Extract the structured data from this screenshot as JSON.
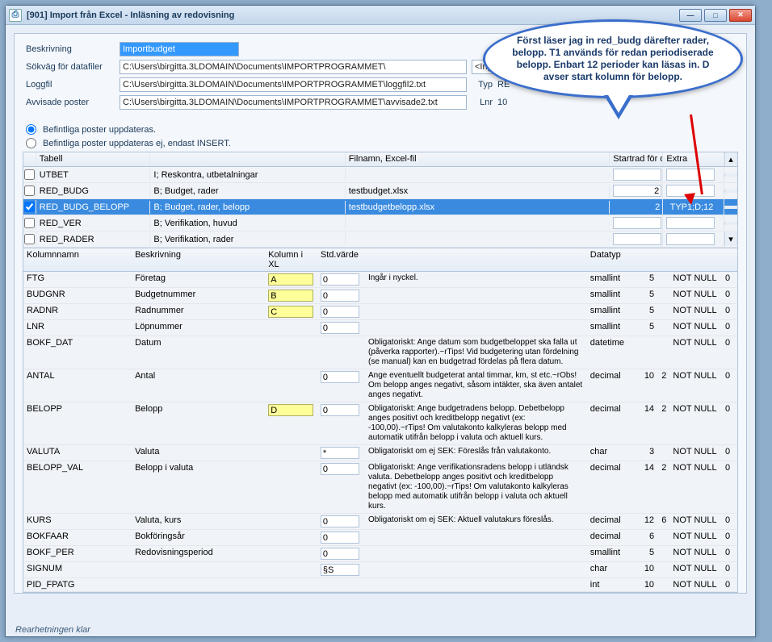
{
  "window": {
    "title": "[901]  Import från Excel - Inläsning av redovisning"
  },
  "form": {
    "beskrivning_lbl": "Beskrivning",
    "beskrivning_val": "Importbudget",
    "sokvag_lbl": "Sökväg för datafiler",
    "sokvag_val": "C:\\Users\\birgitta.3LDOMAIN\\Documents\\IMPORTPROGRAMMET\\",
    "loggfil_lbl": "Loggfil",
    "loggfil_val": "C:\\Users\\birgitta.3LDOMAIN\\Documents\\IMPORTPROGRAMMET\\loggfil2.txt",
    "avvisade_lbl": "Avvisade poster",
    "avvisade_val": "C:\\Users\\birgitta.3LDOMAIN\\Documents\\IMPORTPROGRAMMET\\avvisade2.txt",
    "ingen": "<Ingen>",
    "typ_lbl": "Typ",
    "typ_val": "RE",
    "lnr_lbl": "Lnr",
    "lnr_val": "10",
    "radio1": "Befintliga poster uppdateras.",
    "radio2": "Befintliga poster uppdateras ej, endast INSERT."
  },
  "table_hdr": {
    "tabell": "Tabell",
    "filnamn": "Filnamn, Excel-fil",
    "startrad": "Startrad för data",
    "extra": "Extra"
  },
  "tables": [
    {
      "chk": false,
      "name": "UTBET",
      "desc": "I; Reskontra, utbetalningar",
      "file": "",
      "start": "",
      "extra": ""
    },
    {
      "chk": false,
      "name": "RED_BUDG",
      "desc": "B; Budget, rader",
      "file": "testbudget.xlsx",
      "start": "2",
      "extra": ""
    },
    {
      "chk": true,
      "name": "RED_BUDG_BELOPP",
      "desc": "B; Budget, rader, belopp",
      "file": "testbudgetbelopp.xlsx",
      "start": "2",
      "extra": "TYP1;D;12",
      "sel": true
    },
    {
      "chk": false,
      "name": "RED_VER",
      "desc": "B; Verifikation, huvud",
      "file": "",
      "start": "",
      "extra": ""
    },
    {
      "chk": false,
      "name": "RED_RADER",
      "desc": "B; Verifikation, rader",
      "file": "",
      "start": "",
      "extra": ""
    }
  ],
  "col_hdr": {
    "kolumnnamn": "Kolumnnamn",
    "beskrivning": "Beskrivning",
    "kolumn": "Kolumn i XL",
    "std": "Std.värde",
    "datatyp": "Datatyp"
  },
  "cols": [
    {
      "name": "FTG",
      "desc": "Företag",
      "xl": "A",
      "xlhi": true,
      "sv": "0",
      "note": "Ingår i nyckel.",
      "dt": "smallint",
      "n1": "5",
      "n2": "",
      "nn": "NOT NULL",
      "z": "0"
    },
    {
      "name": "BUDGNR",
      "desc": "Budgetnummer",
      "xl": "B",
      "xlhi": true,
      "sv": "0",
      "note": "",
      "dt": "smallint",
      "n1": "5",
      "n2": "",
      "nn": "NOT NULL",
      "z": "0"
    },
    {
      "name": "RADNR",
      "desc": "Radnummer",
      "xl": "C",
      "xlhi": true,
      "sv": "0",
      "note": "",
      "dt": "smallint",
      "n1": "5",
      "n2": "",
      "nn": "NOT NULL",
      "z": "0"
    },
    {
      "name": "LNR",
      "desc": "Löpnummer",
      "xl": "",
      "xlhi": false,
      "sv": "0",
      "note": "",
      "dt": "smallint",
      "n1": "5",
      "n2": "",
      "nn": "NOT NULL",
      "z": "0"
    },
    {
      "name": "BOKF_DAT",
      "desc": "Datum",
      "xl": "",
      "xlhi": false,
      "sv": "",
      "note": "Obligatoriskt: Ange datum som budgetbeloppet ska falla ut (påverka rapporter).~rTips! Vid budgetering utan fördelning (se manual) kan en budgetrad fördelas på flera datum.",
      "dt": "datetime",
      "n1": "",
      "n2": "",
      "nn": "NOT NULL",
      "z": "0"
    },
    {
      "name": "ANTAL",
      "desc": "Antal",
      "xl": "",
      "xlhi": false,
      "sv": "0",
      "note": "Ange eventuellt budgeterat antal timmar, km, st etc.~rObs! Om belopp anges negativt, såsom intäkter, ska även antalet anges negativt.",
      "dt": "decimal",
      "n1": "10",
      "n2": "2",
      "nn": "NOT NULL",
      "z": "0"
    },
    {
      "name": "BELOPP",
      "desc": "Belopp",
      "xl": "D",
      "xlhi": true,
      "sv": "0",
      "note": "Obligatoriskt: Ange budgetradens belopp. Debetbelopp anges positivt och kreditbelopp negativt (ex: -100,00).~rTips! Om valutakonto kalkyleras belopp med automatik utifrån belopp i valuta och aktuell kurs.",
      "dt": "decimal",
      "n1": "14",
      "n2": "2",
      "nn": "NOT NULL",
      "z": "0"
    },
    {
      "name": "VALUTA",
      "desc": "Valuta",
      "xl": "",
      "xlhi": false,
      "sv": "*",
      "note": "Obligatoriskt om ej SEK: Föreslås från valutakonto.",
      "dt": "char",
      "n1": "3",
      "n2": "",
      "nn": "NOT NULL",
      "z": "0"
    },
    {
      "name": "BELOPP_VAL",
      "desc": "Belopp i valuta",
      "xl": "",
      "xlhi": false,
      "sv": "0",
      "note": "Obligatoriskt: Ange verifikationsradens belopp i utländsk valuta. Debetbelopp anges positivt och kreditbelopp negativt (ex: -100,00).~rTips! Om valutakonto kalkyleras belopp med automatik utifrån belopp i valuta och aktuell kurs.",
      "dt": "decimal",
      "n1": "14",
      "n2": "2",
      "nn": "NOT NULL",
      "z": "0"
    },
    {
      "name": "KURS",
      "desc": "Valuta, kurs",
      "xl": "",
      "xlhi": false,
      "sv": "0",
      "note": "Obligatoriskt om ej SEK: Aktuell valutakurs föreslås.",
      "dt": "decimal",
      "n1": "12",
      "n2": "6",
      "nn": "NOT NULL",
      "z": "0"
    },
    {
      "name": "BOKFAAR",
      "desc": "Bokföringsår",
      "xl": "",
      "xlhi": false,
      "sv": "0",
      "note": "",
      "dt": "decimal",
      "n1": "6",
      "n2": "",
      "nn": "NOT NULL",
      "z": "0"
    },
    {
      "name": "BOKF_PER",
      "desc": "Redovisningsperiod",
      "xl": "",
      "xlhi": false,
      "sv": "0",
      "note": "",
      "dt": "smallint",
      "n1": "5",
      "n2": "",
      "nn": "NOT NULL",
      "z": "0"
    },
    {
      "name": "SIGNUM",
      "desc": "",
      "xl": "",
      "xlhi": false,
      "sv": "§S",
      "note": "",
      "dt": "char",
      "n1": "10",
      "n2": "",
      "nn": "NOT NULL",
      "z": "0"
    },
    {
      "name": "PID_FPATG",
      "desc": "",
      "xl": "",
      "xlhi": false,
      "sv": "",
      "note": "",
      "dt": "int",
      "n1": "10",
      "n2": "",
      "nn": "NOT NULL",
      "z": "0"
    }
  ],
  "callout": "Först läser jag in red_budg därefter rader, belopp. T1 används för redan periodiserade belopp. Enbart 12 perioder kan läsas in. D avser start kolumn för belopp.",
  "status": "Rearhetningen klar"
}
